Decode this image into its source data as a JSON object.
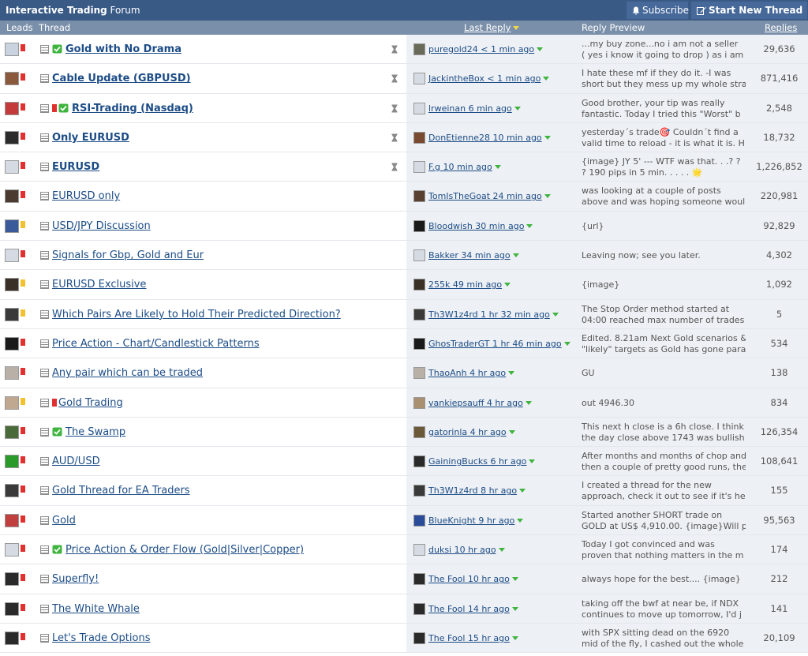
{
  "header": {
    "title_bold": "Interactive Trading",
    "title_rest": " Forum",
    "subscribe_label": "Subscribe",
    "start_thread_label": "Start New Thread"
  },
  "columns": {
    "leads": "Leads",
    "thread": "Thread",
    "last_reply": "Last Reply",
    "reply_preview": "Reply Preview",
    "replies": "Replies"
  },
  "threads": [
    {
      "title": "Gold with No Drama",
      "bold": true,
      "check": true,
      "flag": false,
      "hour": true,
      "last": "puregold24 < 1 min ago",
      "preview": [
        "...my buy zone...no i am not a seller",
        "( yes i know it going to drop ) as i am"
      ],
      "replies": "29,636"
    },
    {
      "title": "Cable Update (GBPUSD)",
      "bold": true,
      "check": false,
      "flag": false,
      "hour": true,
      "last": "JackintheBox < 1 min ago",
      "preview": [
        "I hate these mf if they do it. -I was",
        "short but they mess up my whole stra"
      ],
      "replies": "871,416"
    },
    {
      "title": "RSI-Trading (Nasdaq)",
      "bold": true,
      "check": true,
      "flag": true,
      "hour": true,
      "last": "lrweinan 6 min ago",
      "preview": [
        "Good brother, your tip was really",
        "fantastic. Today I tried this \"Worst\" b"
      ],
      "replies": "2,548"
    },
    {
      "title": "Only EURUSD",
      "bold": true,
      "check": false,
      "flag": false,
      "hour": true,
      "last": "DonEtienne28 10 min ago",
      "preview": [
        "yesterday´s trade🎯 Couldn´t find a",
        "valid time to reload - it is what it is. H"
      ],
      "replies": "18,732"
    },
    {
      "title": "EURUSD",
      "bold": true,
      "check": false,
      "flag": false,
      "hour": true,
      "last": "F.g 10 min ago",
      "preview": [
        "{image} JY 5' --- WTF was that. . .? ?",
        "? 190 pips in 5 min. . . . . 🌟"
      ],
      "replies": "1,226,852"
    },
    {
      "title": "EURUSD only",
      "bold": false,
      "check": false,
      "flag": false,
      "hour": false,
      "last": "TomIsTheGoat 24 min ago",
      "preview": [
        "was looking at a couple of posts",
        "above and was hoping someone woul"
      ],
      "replies": "220,981"
    },
    {
      "title": "USD/JPY Discussion",
      "bold": false,
      "check": false,
      "flag": false,
      "hour": false,
      "last": "Bloodwish 30 min ago",
      "preview": [
        "{url}"
      ],
      "replies": "92,829"
    },
    {
      "title": "Signals for Gbp, Gold and Eur",
      "bold": false,
      "check": false,
      "flag": false,
      "hour": false,
      "last": "Bakker 34 min ago",
      "preview": [
        "Leaving now; see you later."
      ],
      "replies": "4,302"
    },
    {
      "title": "EURUSD Exclusive",
      "bold": false,
      "check": false,
      "flag": false,
      "hour": false,
      "last": "255k 49 min ago",
      "preview": [
        "{image}"
      ],
      "replies": "1,092"
    },
    {
      "title": "Which Pairs Are Likely to Hold Their Predicted Direction?",
      "bold": false,
      "check": false,
      "flag": false,
      "hour": false,
      "last": "Th3W1z4rd 1 hr 32 min ago",
      "preview": [
        "The Stop Order method started at",
        "04:00 reached max number of trades"
      ],
      "replies": "5"
    },
    {
      "title": "Price Action - Chart/Candlestick Patterns",
      "bold": false,
      "check": false,
      "flag": false,
      "hour": false,
      "last": "GhosTraderGT 1 hr 46 min ago",
      "preview": [
        "Edited. 8.21am Next Gold scenarios &",
        "\"likely\" targets as Gold has gone para"
      ],
      "replies": "534"
    },
    {
      "title": "Any pair which can be traded",
      "bold": false,
      "check": false,
      "flag": false,
      "hour": false,
      "last": "ThaoAnh 4 hr ago",
      "preview": [
        "GU"
      ],
      "replies": "138"
    },
    {
      "title": "Gold Trading",
      "bold": false,
      "check": false,
      "flag": true,
      "hour": false,
      "last": "vankiepsauff 4 hr ago",
      "preview": [
        "out 4946.30"
      ],
      "replies": "834"
    },
    {
      "title": "The Swamp",
      "bold": false,
      "check": true,
      "flag": false,
      "hour": false,
      "last": "gatorinla 4 hr ago",
      "preview": [
        "This next h close is a 6h close. I think",
        "the day close above 1743 was bullish"
      ],
      "replies": "126,354"
    },
    {
      "title": "AUD/USD",
      "bold": false,
      "check": false,
      "flag": false,
      "hour": false,
      "last": "GainingBucks 6 hr ago",
      "preview": [
        "After months and months of chop and",
        "then a couple of pretty good runs, the"
      ],
      "replies": "108,641"
    },
    {
      "title": "Gold Thread for EA Traders",
      "bold": false,
      "check": false,
      "flag": false,
      "hour": false,
      "last": "Th3W1z4rd 8 hr ago",
      "preview": [
        "I created a thread for the new",
        "approach, check it out to see if it's he"
      ],
      "replies": "155"
    },
    {
      "title": "Gold",
      "bold": false,
      "check": false,
      "flag": false,
      "hour": false,
      "last": "BlueKnight 9 hr ago",
      "preview": [
        "Started another SHORT trade on",
        "GOLD at US$ 4,910.00. {image}Will p"
      ],
      "replies": "95,563"
    },
    {
      "title": "Price Action & Order Flow (Gold|Silver|Copper)",
      "bold": false,
      "check": true,
      "flag": false,
      "hour": false,
      "last": "duksi 10 hr ago",
      "preview": [
        "Today I got convinced and was",
        "proven that nothing matters in the m"
      ],
      "replies": "174"
    },
    {
      "title": "Superfly!",
      "bold": false,
      "check": false,
      "flag": false,
      "hour": false,
      "last": "The Fool 10 hr ago",
      "preview": [
        "always hope for the best.... {image}"
      ],
      "replies": "212"
    },
    {
      "title": "The White Whale",
      "bold": false,
      "check": false,
      "flag": false,
      "hour": false,
      "last": "The Fool 14 hr ago",
      "preview": [
        "taking off the bwf at near be, if NDX",
        "continues to move up tomorrow, I'd j"
      ],
      "replies": "141"
    },
    {
      "title": "Let's Trade Options",
      "bold": false,
      "check": false,
      "flag": false,
      "hour": false,
      "last": "The Fool 15 hr ago",
      "preview": [
        "with SPX sitting dead on the 6920",
        "mid of the fly, I cashed out the whole"
      ],
      "replies": "20,109"
    }
  ],
  "lead_avatars": [
    "#c9d3df",
    "#8b5a3c",
    "#c43a3a",
    "#2b2b2b",
    "#d6dbe3",
    "#4a3a30",
    "#3b5a9a",
    "#d6dbe3",
    "#3a3028",
    "#3a3a3a",
    "#1a1a1a",
    "#b9b0a8",
    "#c0a890",
    "#4a6a3a",
    "#2a9a2a",
    "#3a3a3a",
    "#c04040",
    "#d6dbe3",
    "#2a2a2a",
    "#2a2a2a",
    "#2a2a2a"
  ],
  "lead_flag_colors": [
    "#e03030",
    "#e03030",
    "#e03030",
    "#e03030",
    "#e03030",
    "#e03030",
    "#f2c22e",
    "#e03030",
    "#f2c22e",
    "#f2c22e",
    "#e03030",
    "#e03030",
    "#f2c22e",
    "#e03030",
    "#e03030",
    "#e03030",
    "#e03030",
    "#e03030",
    "#e03030",
    "#e03030",
    "#e03030"
  ],
  "last_avatars": [
    "#6a6a5a",
    "#d6dbe3",
    "#d6dbe3",
    "#7a4a30",
    "#d6dbe3",
    "#5a4030",
    "#1a1a1a",
    "#d6dbe3",
    "#3a3028",
    "#3a3a3a",
    "#1a1a1a",
    "#b9b0a8",
    "#a89070",
    "#6a5a3a",
    "#2a2a2a",
    "#3a3a3a",
    "#2a4a9a",
    "#d6dbe3",
    "#2a2a2a",
    "#2a2a2a",
    "#2a2a2a"
  ]
}
